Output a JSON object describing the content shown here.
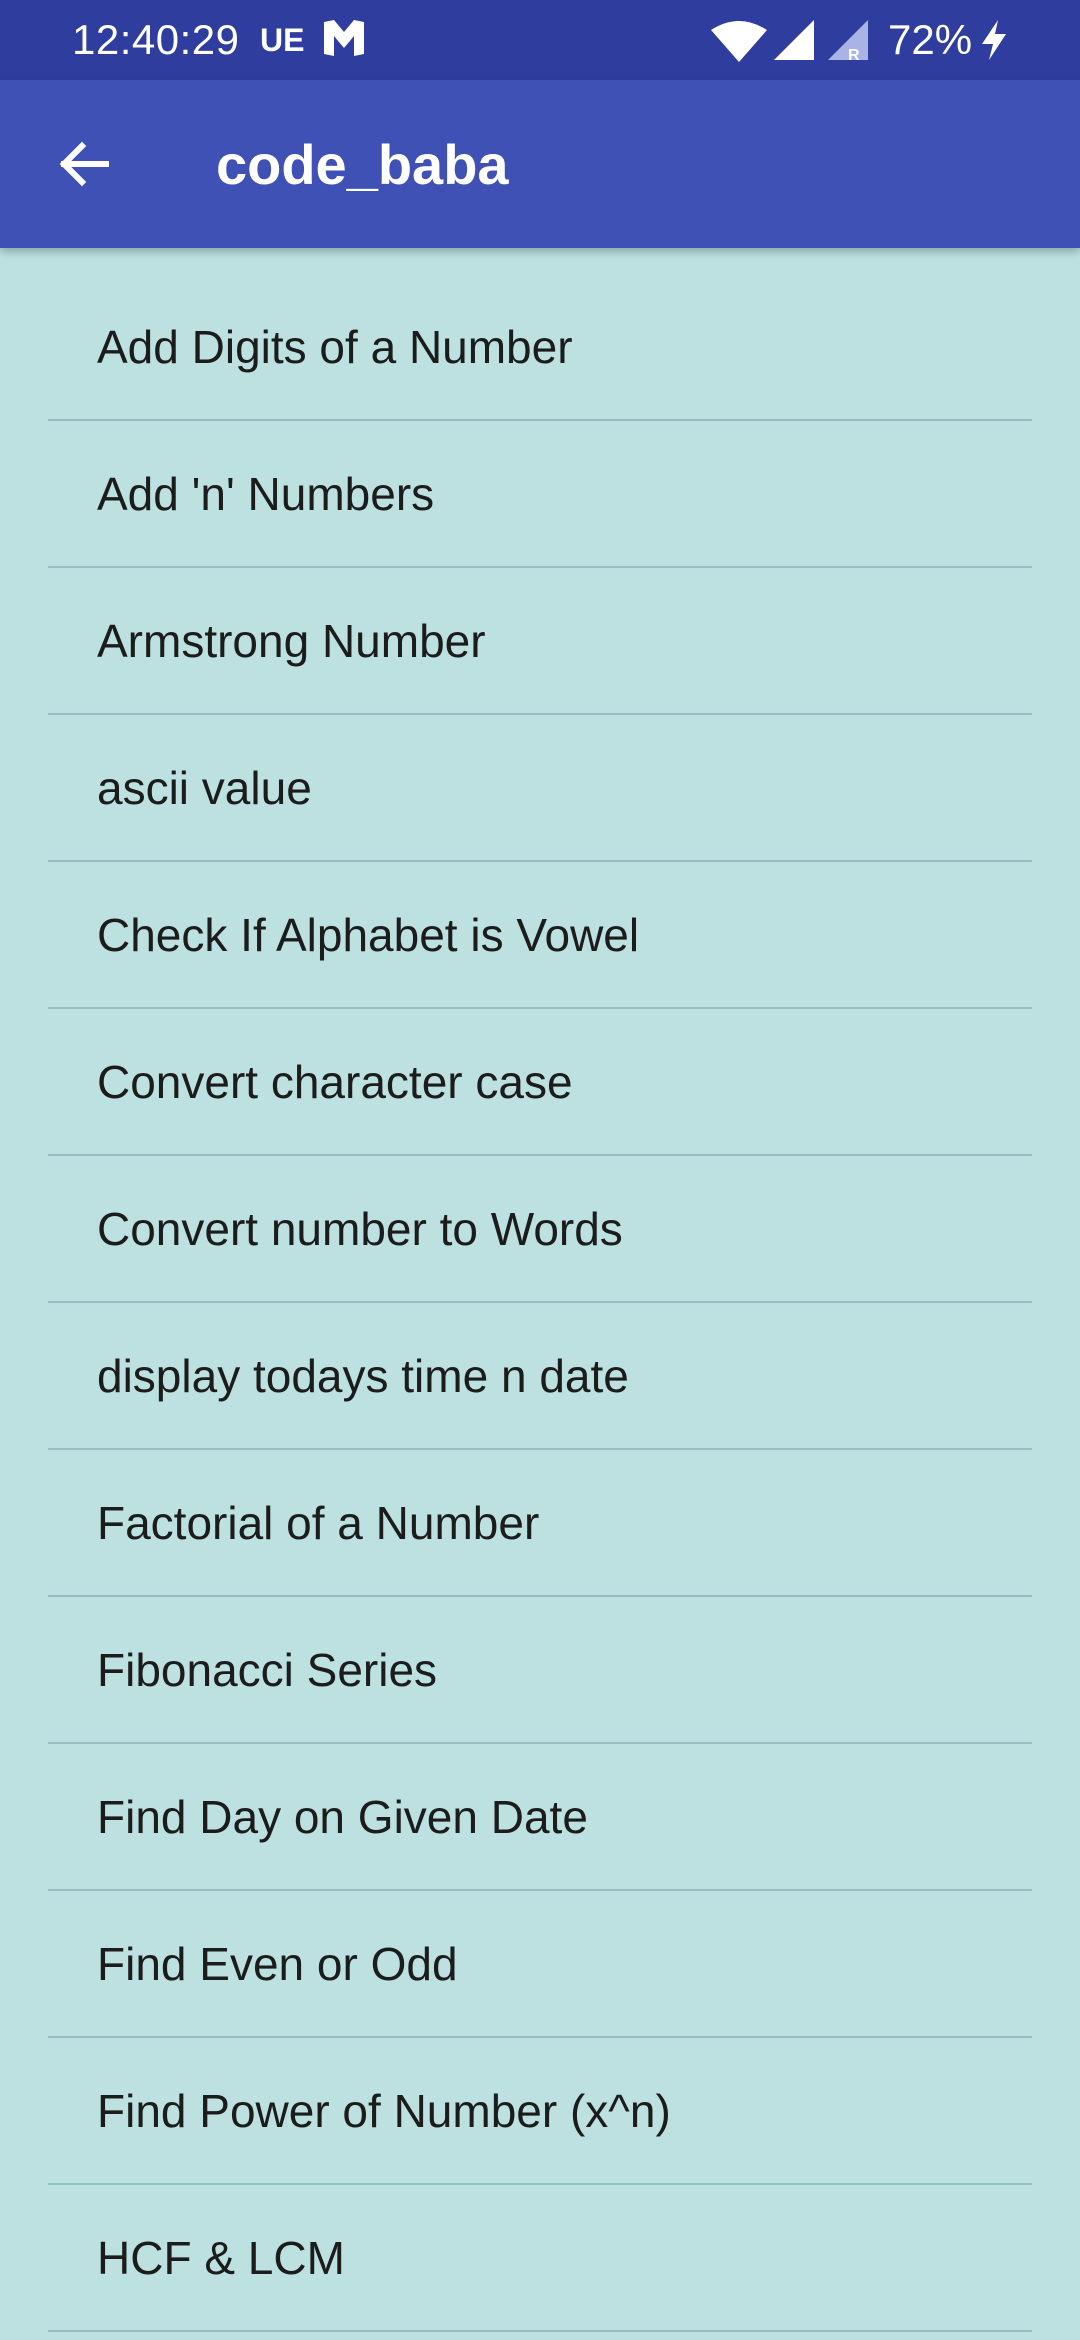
{
  "status_bar": {
    "time": "12:40:29",
    "carrier": "UE",
    "battery": "72%",
    "icons": [
      "m-icon",
      "wifi-icon",
      "signal-icon",
      "signal-roaming-icon",
      "charging-bolt-icon"
    ]
  },
  "app_bar": {
    "title": "code_baba",
    "back_icon": "arrow-left-icon",
    "color": "#3f51b5"
  },
  "list": {
    "items": [
      "Add Digits of a Number",
      "Add 'n' Numbers",
      "Armstrong Number",
      "ascii value",
      "Check If Alphabet is Vowel",
      "Convert character case",
      "Convert number to Words",
      "display todays time n date",
      "Factorial of a Number",
      "Fibonacci Series",
      "Find Day on Given Date",
      "Find Even or Odd",
      "Find Power of Number (x^n)",
      "HCF & LCM"
    ]
  },
  "colors": {
    "status_bar": "#2f3d9e",
    "background": "#bde1e0",
    "divider": "#93bfc0"
  }
}
